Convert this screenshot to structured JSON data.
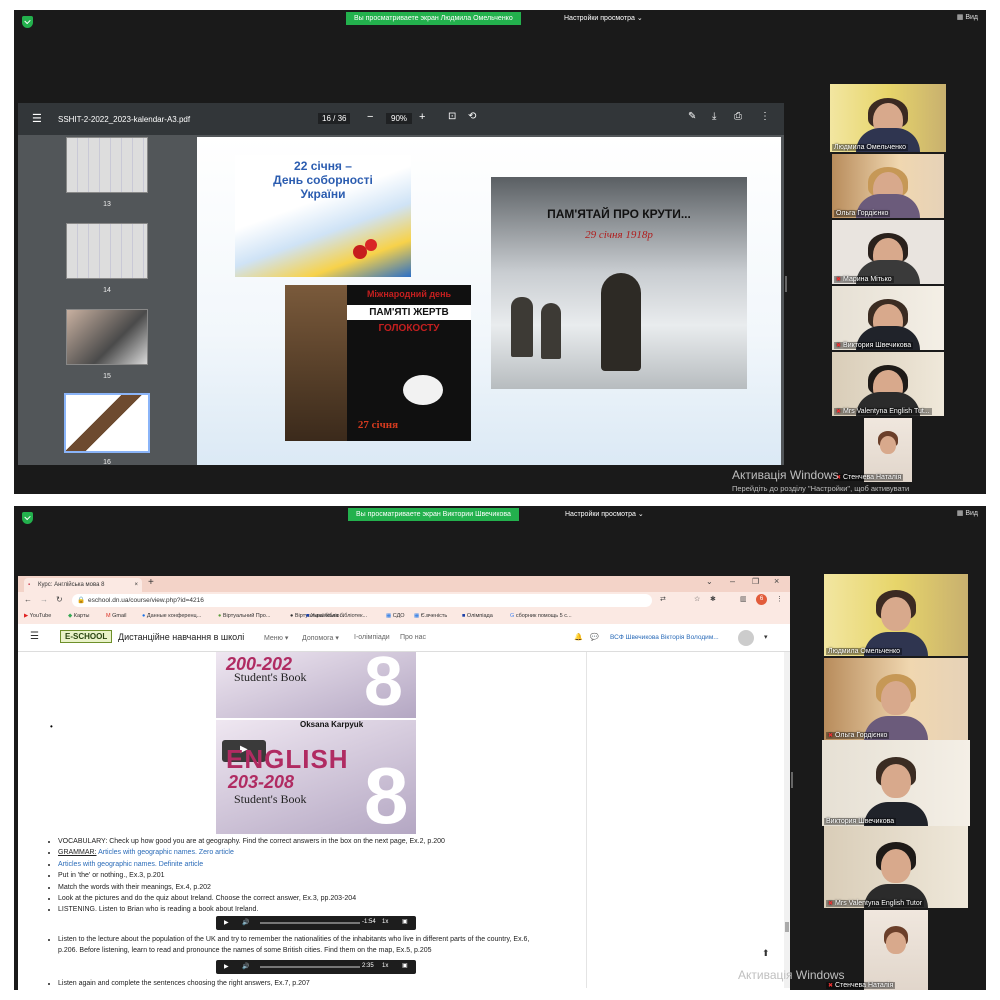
{
  "panel1": {
    "share_banner": "Вы просматриваете экран Людмила Омельченко",
    "view_settings": "Настройки просмотра",
    "view_button": "Вид",
    "pdf": {
      "filename": "SSHIT-2-2022_2023-kalendar-A3.pdf",
      "current_page": "16",
      "total_pages": "36",
      "zoom": "90%",
      "thumbnails": [
        "13",
        "14",
        "15",
        "16"
      ],
      "slide": {
        "title_line1": "22 січня –",
        "title_line2": "День соборності",
        "title_line3": "України",
        "holocaust_line1": "Міжнародний день",
        "holocaust_line2": "ПАМ'ЯТІ ЖЕРТВ",
        "holocaust_line3": "ГОЛОКОСТУ",
        "holocaust_date": "27 січня",
        "kruty_title": "ПАМ'ЯТАЙ ПРО КРУТИ...",
        "kruty_date": "29 січня 1918р"
      }
    },
    "participants": [
      "Людмила Омельченко",
      "Ольга Гордієнко",
      "Марина Мітько",
      "Виктория Швечикова",
      "Mrs Valentyna English Tut...",
      "Стенчева Наталія"
    ],
    "activation_title": "Активація Windows",
    "activation_sub": "Перейдіть до розділу \"Настройки\", щоб активувати"
  },
  "panel2": {
    "share_banner": "Вы просматриваете экран Виктории Швечикова",
    "view_settings": "Настройки просмотра",
    "view_button": "Вид",
    "browser": {
      "tab_title": "Курс: Англійська мова 8",
      "url": "eschool.dn.ua/course/view.php?id=4216",
      "bookmarks": [
        "YouTube",
        "Карты",
        "Gmail",
        "Данные конференц...",
        "Віртуальний Про...",
        "Віртуальна бібліо...",
        "Українська бібліотек...",
        "СДО",
        "Є.вченість",
        "Олімпіада",
        "сборник помощь 5 с..."
      ],
      "site_logo": "E-SCHOOL",
      "site_title": "Дистанційне навчання в школі",
      "menu": [
        "Меню",
        "Допомога",
        "І-олімпіади",
        "Про нас"
      ],
      "user_name": "ВСФ Швечикова Вікторія Володим...",
      "book1_pages": "200-202",
      "book1_sub": "Student's Book",
      "book_author": "Oksana Karpyuk",
      "book2_title": "ENGLISH",
      "book2_pages": "203-208",
      "book2_sub": "Student's Book",
      "book_num": "8",
      "tasks": [
        "VOCABULARY: Check up how good you are at geography. Find the correct answers in the box on the next page, Ex.2, p.200",
        "GRAMMAR:",
        "Articles with geographic names. Definite article",
        "Put in 'the' or nothing., Ex.3, p.201",
        "Match the words with their meanings, Ex.4, p.202",
        "Look at the pictures and do the quiz about Ireland. Choose the correct answer, Ex.3, pp.203-204",
        "LISTENING. Listen to Brian who is reading a book about Ireland."
      ],
      "grammar_link": "Articles with geographic names. Zero article",
      "audio1_time": "-1:54",
      "audio2_time": "2:35",
      "audio_speed": "1x",
      "lecture_line1": "Listen to the lecture about the population of the UK and try to remember the nationalities of the inhabitants who live in different parts of the country, Ex.6,",
      "lecture_line2": "p.206. Before listening, learn to read and pronounce the names of some British cities. Find them on the map, Ex.5, p.205",
      "last_line": "Listen again and complete the sentences choosing the right answers, Ex.7, p.207"
    },
    "participants": [
      "Людмила Омельченко",
      "Ольга Гордієнко",
      "Виктория Швечикова",
      "Mrs Valentyna English Tutor",
      "Стенчева Наталія"
    ],
    "activation_title": "Активація Windows"
  },
  "colors": {
    "banner_green": "#23b14d",
    "active_speaker": "#c9d32b",
    "pdf_toolbar": "#323639",
    "chrome_tab": "#f3d3c8",
    "link_blue": "#2a6bb8"
  }
}
